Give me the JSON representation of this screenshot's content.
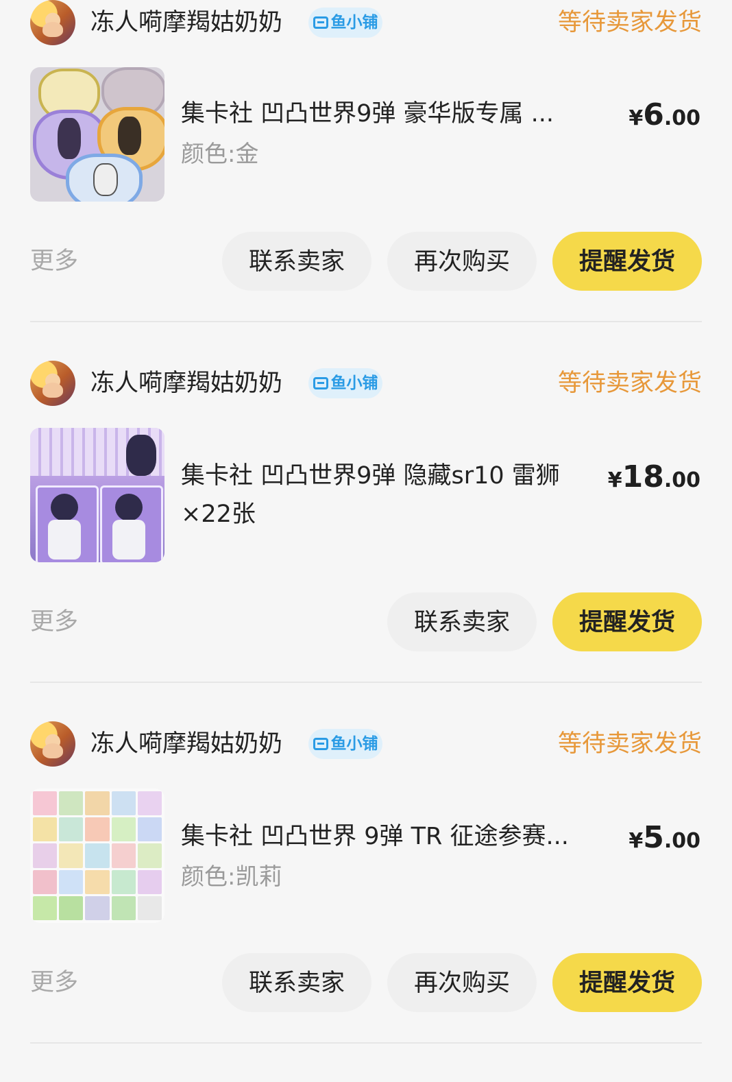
{
  "orders": [
    {
      "seller_name": "冻人嗬摩羯姑奶奶",
      "shop_badge": "鱼小铺",
      "status": "等待卖家发货",
      "product_title": "集卡社 凹凸世界9弹 豪华版专属 ...",
      "product_spec": "颜色:金",
      "price_symbol": "¥",
      "price_int": "6",
      "price_dec": ".00",
      "more_label": "更多",
      "buttons": [
        "联系卖家",
        "再次购买",
        "提醒发货"
      ]
    },
    {
      "seller_name": "冻人嗬摩羯姑奶奶",
      "shop_badge": "鱼小铺",
      "status": "等待卖家发货",
      "product_title": "集卡社 凹凸世界9弹 隐藏sr10 雷狮 ×22张",
      "product_spec": "",
      "price_symbol": "¥",
      "price_int": "18",
      "price_dec": ".00",
      "more_label": "更多",
      "buttons": [
        "联系卖家",
        "提醒发货"
      ]
    },
    {
      "seller_name": "冻人嗬摩羯姑奶奶",
      "shop_badge": "鱼小铺",
      "status": "等待卖家发货",
      "product_title": "集卡社 凹凸世界 9弹 TR 征途参赛...",
      "product_spec": "颜色:凯莉",
      "price_symbol": "¥",
      "price_int": "5",
      "price_dec": ".00",
      "more_label": "更多",
      "buttons": [
        "联系卖家",
        "再次购买",
        "提醒发货"
      ]
    }
  ],
  "colors": {
    "status": "#e7983a",
    "primary_button": "#f5d94a",
    "secondary_button": "#efefef",
    "badge_bg": "#dff0fb",
    "badge_text": "#2a9be5"
  },
  "icons": {
    "avatar": "seller-avatar",
    "badge": "shop-icon"
  }
}
